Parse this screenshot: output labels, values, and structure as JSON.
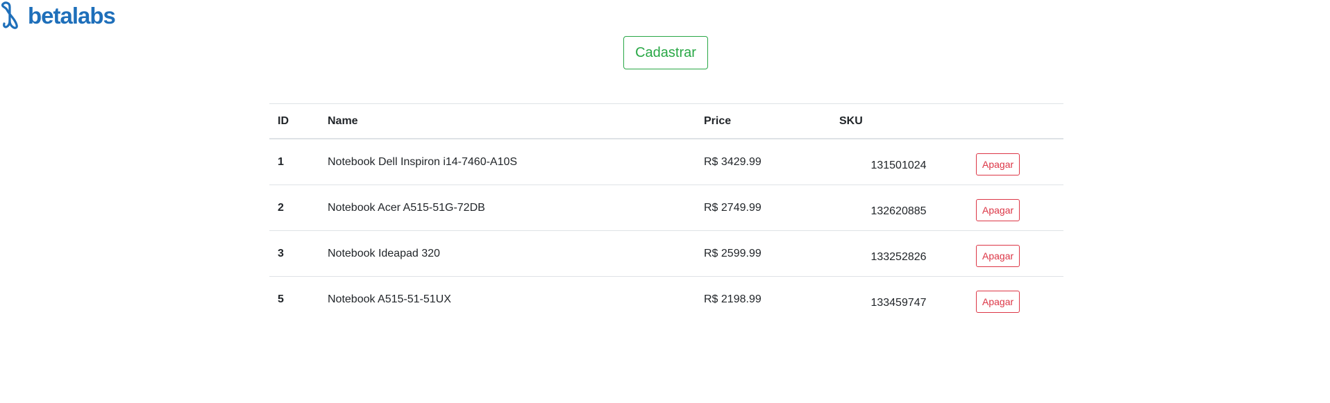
{
  "logo": {
    "text": "betalabs",
    "color": "#1e6fba"
  },
  "actions": {
    "cadastrar_label": "Cadastrar",
    "cadastrar_color": "#28a745"
  },
  "table": {
    "headers": {
      "id": "ID",
      "name": "Name",
      "price": "Price",
      "sku": "SKU"
    },
    "rows": [
      {
        "id": "1",
        "name": "Notebook Dell Inspiron i14-7460-A10S",
        "price": "R$ 3429.99",
        "sku": "131501024",
        "action": "Apagar"
      },
      {
        "id": "2",
        "name": "Notebook Acer A515-51G-72DB",
        "price": "R$ 2749.99",
        "sku": "132620885",
        "action": "Apagar"
      },
      {
        "id": "3",
        "name": "Notebook Ideapad 320",
        "price": "R$ 2599.99",
        "sku": "133252826",
        "action": "Apagar"
      },
      {
        "id": "5",
        "name": "Notebook A515-51-51UX",
        "price": "R$ 2198.99",
        "sku": "133459747",
        "action": "Apagar"
      }
    ],
    "delete_color": "#dc3545"
  }
}
